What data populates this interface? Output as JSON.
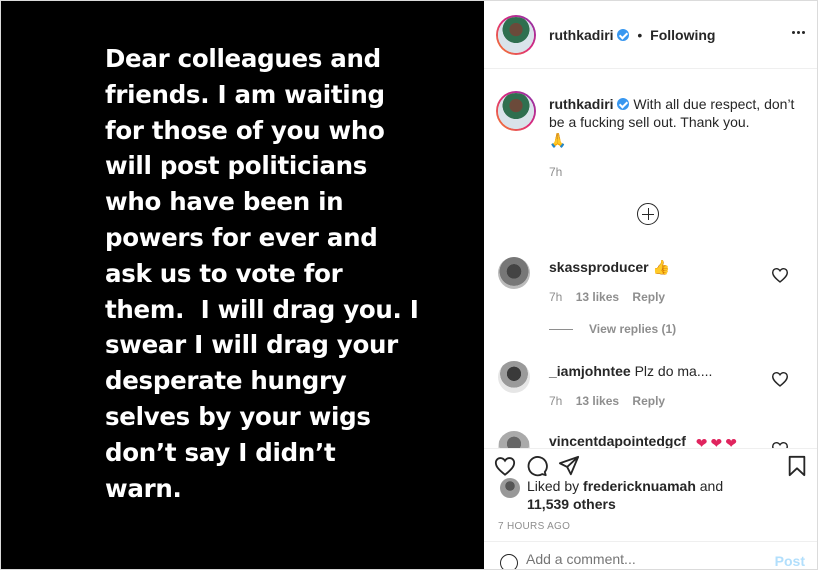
{
  "post": {
    "image_text": [
      "Dear colleagues and",
      "friends. I am waiting",
      "for those of you who",
      "will post politicians",
      "who have been in",
      "powers for ever and",
      "ask us to vote for",
      "them.  I will drag you. I",
      "swear I will drag your",
      "desperate hungry",
      "selves by your wigs",
      "don’t say I didn’t",
      "warn."
    ]
  },
  "header": {
    "username": "ruthkadiri",
    "separator": "•",
    "following_label": "Following"
  },
  "caption": {
    "username": "ruthkadiri",
    "text": "With all due respect, don’t be a fucking sell out. Thank you.",
    "emoji": "🙏",
    "time": "7h"
  },
  "comments": [
    {
      "username": "skassproducer",
      "text": "",
      "emoji": "👍",
      "time": "7h",
      "likes": "13 likes",
      "reply_label": "Reply",
      "view_replies": "View replies (1)"
    },
    {
      "username": "_iamjohntee",
      "text": "Plz do ma....",
      "time": "7h",
      "likes": "13 likes",
      "reply_label": "Reply"
    },
    {
      "username": "vincentdapointedgcf",
      "emoji": [
        "❤",
        "❤",
        "❤"
      ]
    }
  ],
  "likes": {
    "prefix": "Liked by",
    "user": "fredericknuamah",
    "conj": "and",
    "others": "11,539 others"
  },
  "posted_time": "7 HOURS AGO",
  "add_comment": {
    "placeholder": "Add a comment...",
    "post_label": "Post"
  },
  "colors": {
    "verified": "#3897f0",
    "muted": "#8e8e8e",
    "post_disabled": "#b2dffc"
  }
}
